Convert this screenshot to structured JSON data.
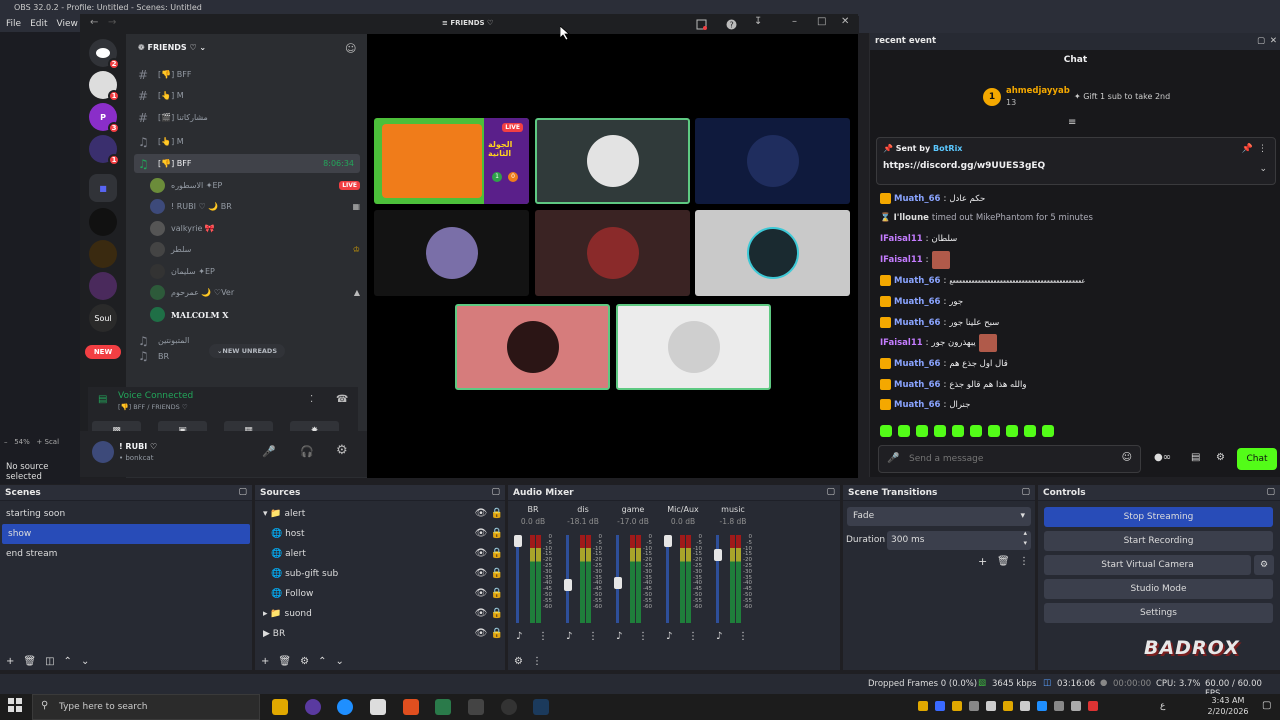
{
  "obs": {
    "title": "OBS 32.0.2 - Profile: Untitled - Scenes: Untitled",
    "menu": [
      "File",
      "Edit",
      "View"
    ],
    "zoom": "54%",
    "scale_label": "Scal",
    "no_source": "No source selected"
  },
  "discord": {
    "window_title": "FRIENDS ♡",
    "server_name": "FRIENDS ♡",
    "guild_badges": [
      "2",
      "1",
      "3",
      "1"
    ],
    "new_badge": "NEW",
    "soul_label": "Soul",
    "channels": [
      {
        "icon": "#",
        "label": "[👎] BFF"
      },
      {
        "icon": "#",
        "label": "[👆] M"
      },
      {
        "icon": "#",
        "label": "[🎬] مشاركاتنا"
      },
      {
        "icon": "♫",
        "label": "[👆] M"
      }
    ],
    "active_channel": {
      "label": "[👎] BFF",
      "timer": "8:06:34"
    },
    "voice_users": [
      {
        "name": "الاسطوره ✦EP",
        "tag": "LIVE"
      },
      {
        "name": "! RUBI ♡ 🌙 BR",
        "tag": ""
      },
      {
        "name": "valkyrie 🎀",
        "tag": ""
      },
      {
        "name": "سلطر",
        "tag": ""
      },
      {
        "name": "سليمان ✦EP",
        "tag": ""
      },
      {
        "name": "عمرحوم 🌙 ♡Ver",
        "tag": ""
      },
      {
        "name": "MALCOLM X",
        "tag": ""
      }
    ],
    "more_channel": "المتبونتين",
    "more_channel_2": "BR",
    "new_unreads": "NEW UNREADS",
    "voice_connected": "Voice Connected",
    "voice_path": "[👎] BFF / FRIENDS ♡",
    "user_name": "! RUBI ♡",
    "user_status": "bonkcat",
    "tile_live": "LIVE",
    "tile_title": "الجولة الثانية",
    "tile_score_a": "1",
    "tile_score_b": "0"
  },
  "chat": {
    "header": "recent event",
    "title": "Chat",
    "top_user": "ahmedjayyab",
    "top_count": "13",
    "gift_text": "Gift 1 sub to take 2nd",
    "sent_by_label": "Sent by",
    "sent_by_name": "BotRix",
    "pinned_link": "https://discord.gg/w9UUES3gEQ",
    "messages": [
      {
        "user": "Muath_66",
        "color": "#8aa4ff",
        "text": "حكم عادل"
      },
      {
        "user": "I'lloune",
        "color": "#bdbdbd",
        "text": "timed out MikePhantom for 5 minutes"
      },
      {
        "user": "IFaisal11",
        "color": "#c47cff",
        "text": "سلطان"
      },
      {
        "user": "IFaisal11",
        "color": "#c47cff",
        "text": ""
      },
      {
        "user": "Muath_66",
        "color": "#8aa4ff",
        "text": "ععععععععععععععععععععععععععععععععععععععععععع"
      },
      {
        "user": "Muath_66",
        "color": "#8aa4ff",
        "text": "جور"
      },
      {
        "user": "Muath_66",
        "color": "#8aa4ff",
        "text": "سبح علينا جور"
      },
      {
        "user": "IFaisal11",
        "color": "#c47cff",
        "text": "يبهذرون جور"
      },
      {
        "user": "Muath_66",
        "color": "#8aa4ff",
        "text": "قال اول جذع هم"
      },
      {
        "user": "Muath_66",
        "color": "#8aa4ff",
        "text": "والله هذا هم قالو جذع"
      },
      {
        "user": "Muath_66",
        "color": "#8aa4ff",
        "text": "جنرال"
      }
    ],
    "placeholder": "Send a message",
    "chat_button": "Chat"
  },
  "scenes": {
    "title": "Scenes",
    "items": [
      "starting soon",
      "show",
      "end stream"
    ],
    "selected": 1
  },
  "sources": {
    "title": "Sources",
    "items": [
      {
        "label": "alert",
        "type": "folder",
        "indent": 0
      },
      {
        "label": "host",
        "type": "globe",
        "indent": 1
      },
      {
        "label": "alert",
        "type": "globe",
        "indent": 1
      },
      {
        "label": "sub-gift sub",
        "type": "globe",
        "indent": 1
      },
      {
        "label": "Follow",
        "type": "globe",
        "indent": 1
      },
      {
        "label": "suond",
        "type": "folder",
        "indent": 0
      },
      {
        "label": "BR",
        "type": "play",
        "indent": 0
      }
    ]
  },
  "mixer": {
    "title": "Audio Mixer",
    "channels": [
      {
        "name": "BR",
        "db": "0.0 dB",
        "level": 1.0
      },
      {
        "name": "dis",
        "db": "-18.1 dB",
        "level": 0.45
      },
      {
        "name": "game",
        "db": "-17.0 dB",
        "level": 0.47
      },
      {
        "name": "Mic/Aux",
        "db": "0.0 dB",
        "level": 1.0
      },
      {
        "name": "music",
        "db": "-1.8 dB",
        "level": 0.82
      }
    ],
    "scale": [
      "0",
      "-5",
      "-10",
      "-15",
      "-20",
      "-25",
      "-30",
      "-35",
      "-40",
      "-45",
      "-50",
      "-55",
      "-60"
    ]
  },
  "transitions": {
    "title": "Scene Transitions",
    "selected": "Fade",
    "duration_label": "Duration",
    "duration_value": "300 ms"
  },
  "controls": {
    "title": "Controls",
    "stop_streaming": "Stop Streaming",
    "start_recording": "Start Recording",
    "start_virtual_camera": "Start Virtual Camera",
    "studio_mode": "Studio Mode",
    "settings": "Settings"
  },
  "watermark": "BADROX",
  "status": {
    "dropped_frames": "Dropped Frames 0 (0.0%)",
    "bitrate": "3645 kbps",
    "stream_time": "03:16:06",
    "rec_time": "00:00:00",
    "cpu": "CPU: 3.7%",
    "fps": "60.00 / 60.00 FPS"
  },
  "taskbar": {
    "search_placeholder": "Type here to search",
    "time": "3:43 AM",
    "date": "2/20/2026",
    "lang": "ع"
  },
  "colors": {
    "accent_blue": "#3b4ec9",
    "live_red": "#f23f43",
    "chat_green": "#53fc18"
  }
}
